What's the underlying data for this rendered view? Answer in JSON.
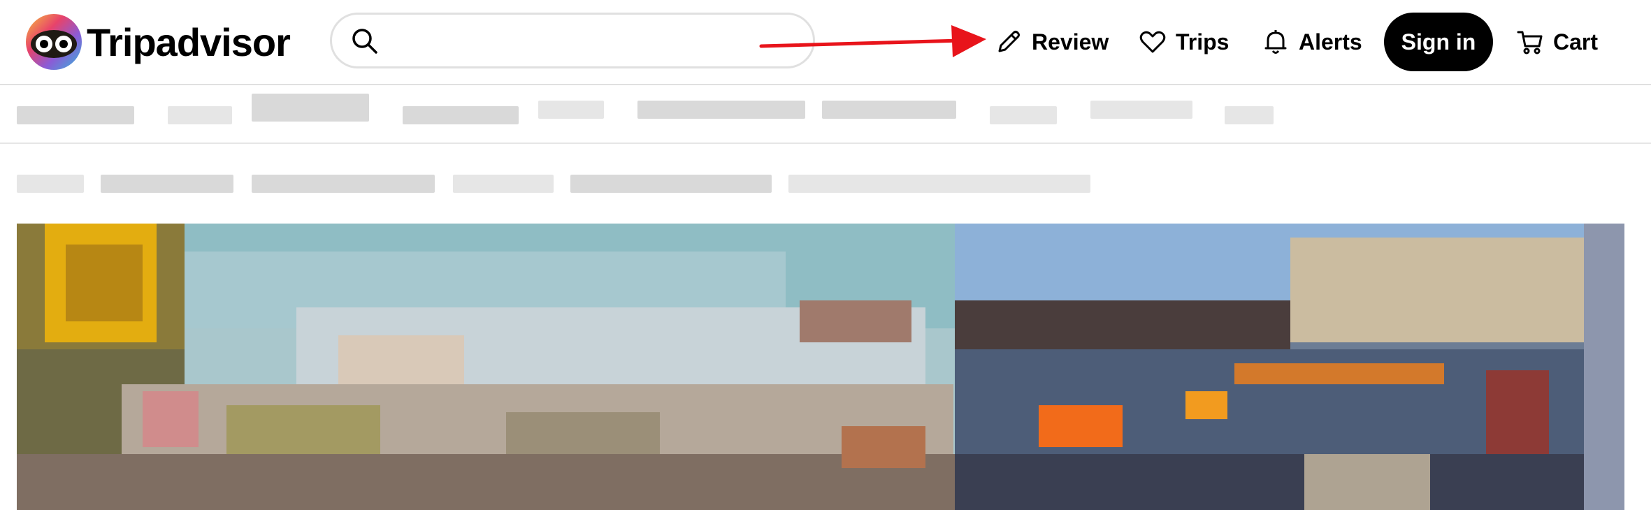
{
  "brand": {
    "name": "Tripadvisor"
  },
  "search": {
    "value": "",
    "placeholder": ""
  },
  "nav": {
    "review_label": "Review",
    "trips_label": "Trips",
    "alerts_label": "Alerts",
    "signin_label": "Sign in",
    "cart_label": "Cart"
  },
  "colors": {
    "accent": "#000000",
    "annotation_arrow": "#e8141b",
    "border": "#e0e0e0"
  },
  "icons": {
    "logo": "owl-logo-icon",
    "search": "search-icon",
    "review": "pencil-icon",
    "trips": "heart-icon",
    "alerts": "bell-icon",
    "cart": "cart-icon"
  }
}
